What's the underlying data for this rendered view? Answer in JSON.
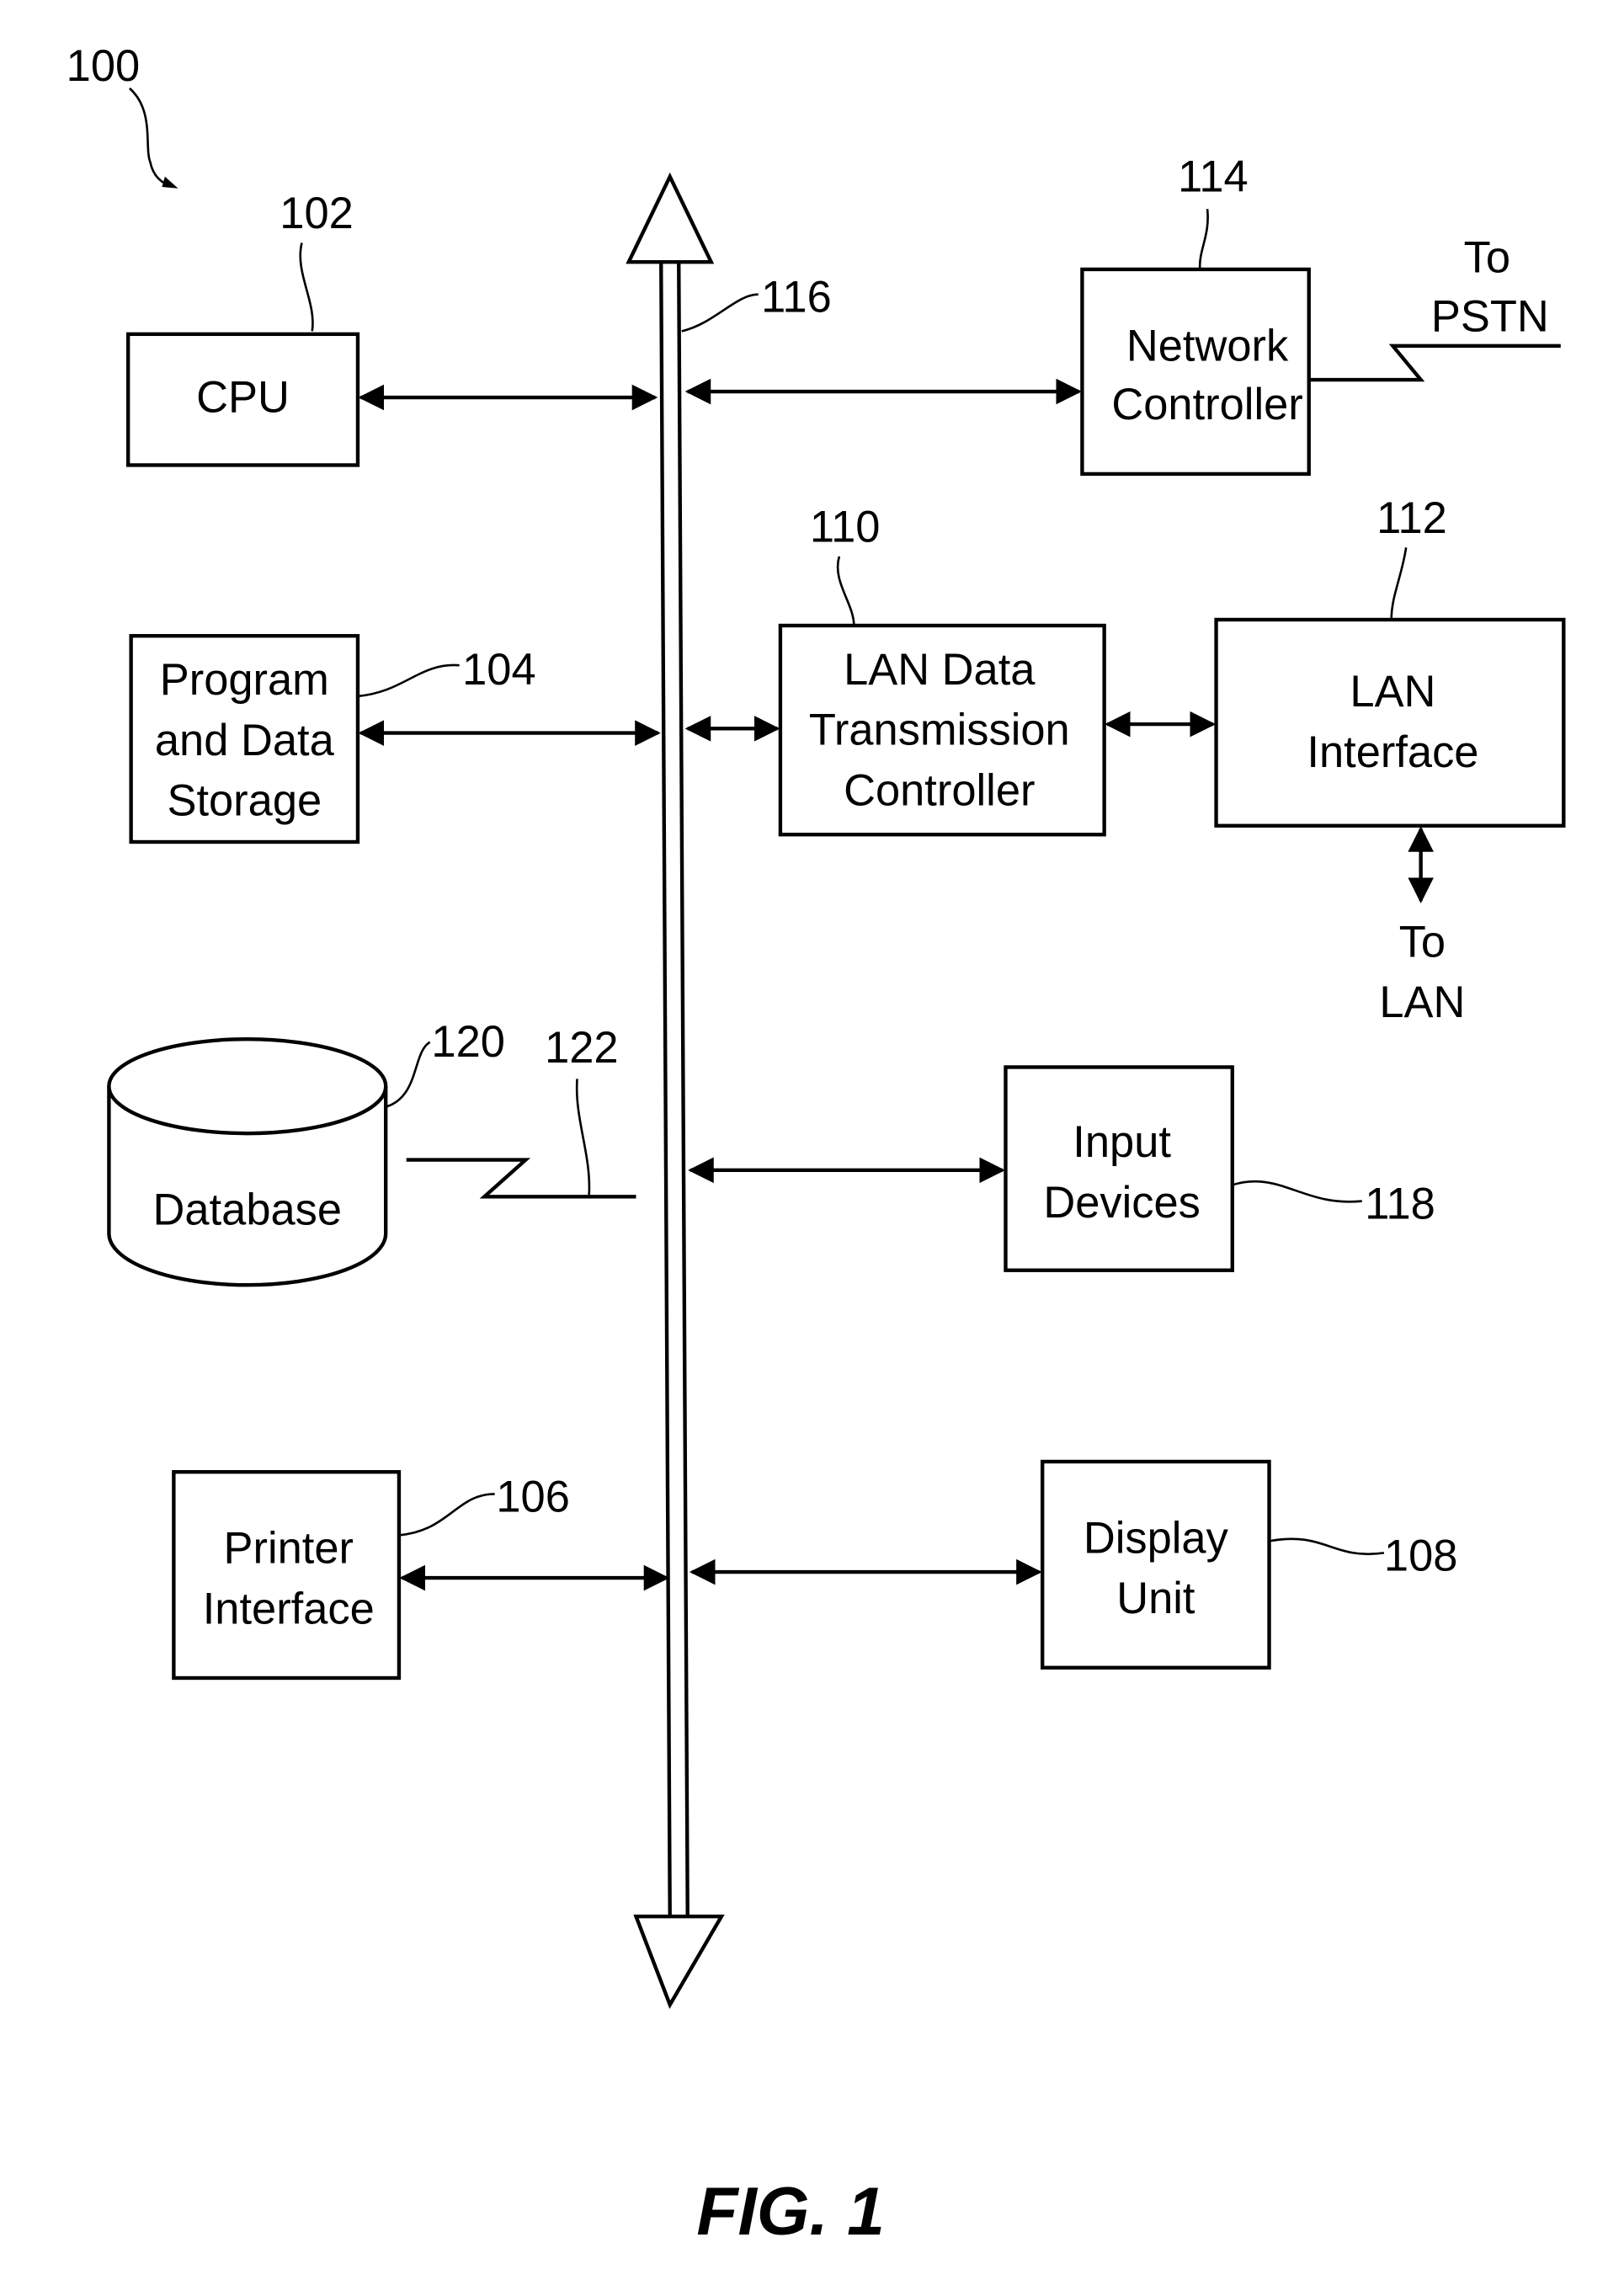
{
  "figure": {
    "caption": "FIG. 1",
    "system_ref": "100",
    "bus_ref": "116"
  },
  "blocks": {
    "cpu": {
      "ref": "102",
      "lines": [
        "CPU"
      ]
    },
    "storage": {
      "ref": "104",
      "lines": [
        "Program",
        "and Data",
        "Storage"
      ]
    },
    "printer": {
      "ref": "106",
      "lines": [
        "Printer",
        "Interface"
      ]
    },
    "display": {
      "ref": "108",
      "lines": [
        "Display",
        "Unit"
      ]
    },
    "lan_ctrl": {
      "ref": "110",
      "lines": [
        "LAN Data",
        "Transmission",
        "Controller"
      ]
    },
    "lan_if": {
      "ref": "112",
      "lines": [
        "LAN",
        "Interface"
      ]
    },
    "net_ctrl": {
      "ref": "114",
      "lines": [
        "Network",
        "Controller"
      ]
    },
    "input": {
      "ref": "118",
      "lines": [
        "Input",
        "Devices"
      ]
    },
    "database": {
      "ref": "120",
      "lines": [
        "Database"
      ]
    },
    "db_link": {
      "ref": "122"
    }
  },
  "externals": {
    "pstn": [
      "To",
      "PSTN"
    ],
    "lan": [
      "To",
      "LAN"
    ]
  }
}
